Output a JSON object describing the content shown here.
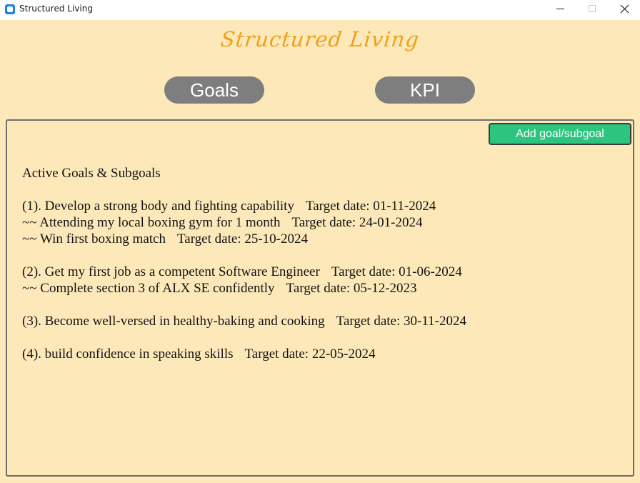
{
  "window": {
    "title": "Structured Living",
    "icon": "app-icon",
    "controls": [
      "minimize-icon",
      "maximize-icon",
      "close-icon"
    ]
  },
  "header": {
    "app_title": "Structured Living"
  },
  "nav": {
    "goals_label": "Goals",
    "kpi_label": "KPI"
  },
  "panel": {
    "add_button_label": "Add goal/subgoal",
    "heading": "Active Goals & Subgoals",
    "goals": [
      {
        "text": "(1). Develop a strong body and fighting capability",
        "target": "Target date: 01-11-2024",
        "subgoals": [
          {
            "text": "~~ Attending my local boxing gym for 1 month",
            "target": "Target date: 24-01-2024"
          },
          {
            "text": "~~ Win first boxing match",
            "target": "Target date: 25-10-2024"
          }
        ]
      },
      {
        "text": "(2). Get my first job as a competent Software Engineer",
        "target": "Target date: 01-06-2024",
        "subgoals": [
          {
            "text": "~~ Complete section 3 of ALX SE confidently",
            "target": "Target date: 05-12-2023"
          }
        ]
      },
      {
        "text": "(3). Become well-versed in healthy-baking and cooking",
        "target": "Target date: 30-11-2024",
        "subgoals": []
      },
      {
        "text": "(4). build confidence in speaking skills",
        "target": "Target date: 22-05-2024",
        "subgoals": []
      }
    ]
  },
  "colors": {
    "background": "#fce8b9",
    "title_accent": "#efa11a",
    "tab_button": "#7e7e7e",
    "add_button": "#2cc57f"
  }
}
